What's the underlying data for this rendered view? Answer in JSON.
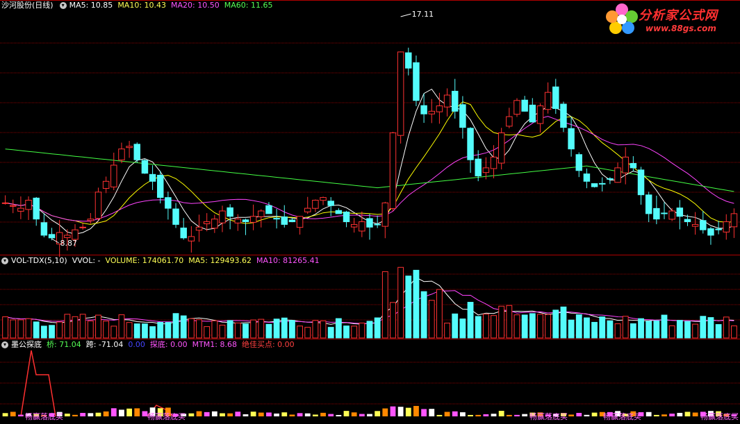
{
  "main_header": {
    "title": "沙河股份(日线)",
    "items": [
      {
        "label": "MA5: 10.85",
        "color": "#ffffff"
      },
      {
        "label": "MA10: 10.43",
        "color": "#ffff55"
      },
      {
        "label": "MA20: 10.50",
        "color": "#ff55ff"
      },
      {
        "label": "MA60: 11.65",
        "color": "#55ff55"
      }
    ]
  },
  "vol_header": {
    "title": "VOL-TDX(5,10)",
    "items": [
      {
        "label": "VVOL: -",
        "color": "#ffffff"
      },
      {
        "label": "VOLUME: 174061.70",
        "color": "#ffff55"
      },
      {
        "label": "MA5: 129493.62",
        "color": "#ffff55"
      },
      {
        "label": "MA10: 81265.41",
        "color": "#ff55ff"
      }
    ]
  },
  "ind_header": {
    "title": "墨公探底",
    "items": [
      {
        "label": "桥: 71.04",
        "color": "#55ff55"
      },
      {
        "label": "跨: -71.04",
        "color": "#ffffff"
      },
      {
        "label": "0.00",
        "color": "#4444ff"
      },
      {
        "label": "探底: 0.00",
        "color": "#ff55ff"
      },
      {
        "label": "MTM1: 8.68",
        "color": "#ff55ff"
      },
      {
        "label": "绝佳买点: 0.00",
        "color": "#ff4040"
      }
    ]
  },
  "annotations": {
    "high_price": "17.11",
    "low_price": "8.87",
    "signal_label": "畅赢落底买"
  },
  "logo": {
    "text": "分析家公式网",
    "url": "www.88gs.com"
  },
  "colors": {
    "up": "#ff3232",
    "down": "#54fcfc",
    "grid": "#8b0000",
    "ma5": "#ffffff",
    "ma10": "#ffff00",
    "ma20": "#ff44ff",
    "ma60": "#44ff44"
  },
  "chart_data": {
    "type": "candlestick",
    "y_range": [
      8.87,
      17.11
    ],
    "close_prices": [
      10.2,
      10.1,
      10.0,
      10.3,
      9.6,
      9.0,
      8.9,
      9.1,
      9.0,
      9.2,
      9.3,
      9.6,
      10.6,
      11.0,
      11.6,
      12.2,
      12.3,
      11.8,
      11.3,
      11.0,
      10.4,
      10.0,
      9.4,
      8.9,
      8.95,
      9.3,
      9.5,
      9.6,
      9.9,
      9.7,
      9.6,
      9.5,
      9.7,
      9.9,
      9.8,
      9.6,
      9.4,
      9.5,
      9.7,
      10.0,
      10.3,
      10.4,
      10.1,
      9.8,
      9.5,
      9.4,
      9.5,
      9.3,
      9.4,
      10.2,
      12.8,
      15.8,
      15.2,
      14.0,
      13.5,
      13.6,
      13.8,
      14.2,
      13.6,
      13.0,
      11.8,
      11.2,
      11.5,
      11.9,
      12.8,
      13.4,
      14.0,
      13.6,
      13.2,
      13.8,
      14.3,
      13.7,
      13.0,
      12.2,
      11.4,
      11.0,
      10.8,
      10.9,
      11.1,
      11.5,
      11.9,
      11.5,
      10.5,
      9.8,
      9.6,
      9.8,
      9.9,
      9.7,
      9.5,
      9.4,
      9.2,
      9.0,
      9.2,
      9.5,
      9.8
    ],
    "volume_ma_lines": [
      "MA5",
      "MA10"
    ],
    "indicator_series": [
      "桥",
      "跨",
      "探底",
      "MTM1",
      "绝佳买点"
    ]
  }
}
